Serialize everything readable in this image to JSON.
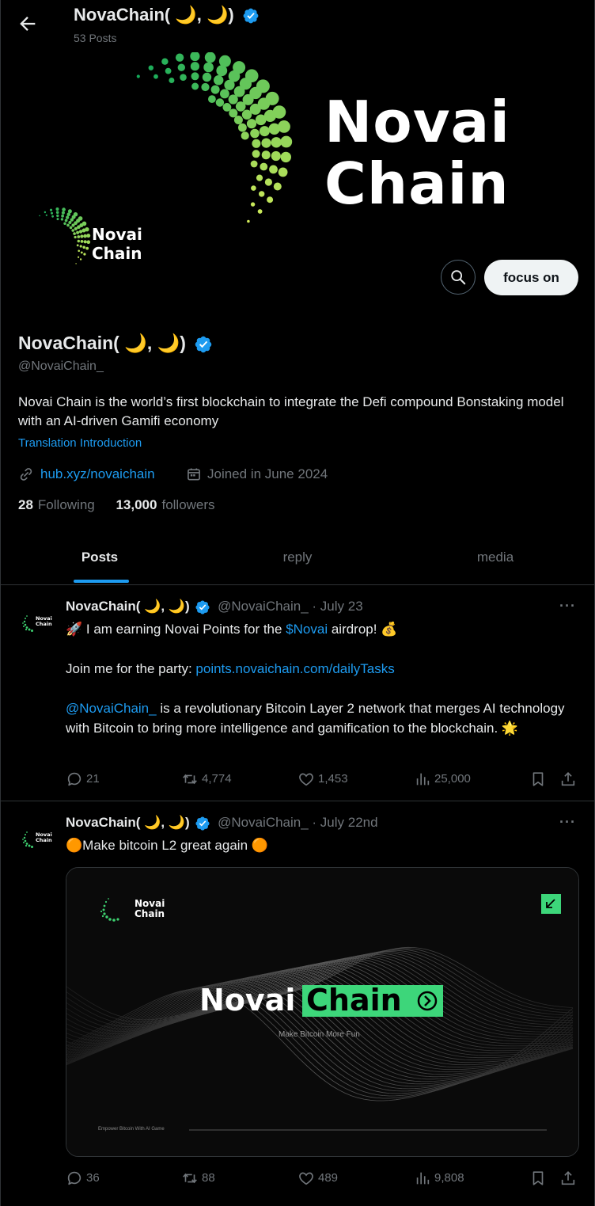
{
  "header": {
    "back_icon": "arrow-left-icon",
    "name": "NovaChain( 🌙, 🌙)",
    "posts_count": "53 Posts"
  },
  "banner": {
    "title_line1": "Novai",
    "title_line2": "Chain",
    "logo_line1": "Novai",
    "logo_line2": "Chain"
  },
  "actions": {
    "search_icon": "search-icon",
    "follow_label": "focus on"
  },
  "profile": {
    "name": "NovaChain( 🌙, 🌙)",
    "handle": "@NovaiChain_",
    "bio": "Novai Chain is the world’s first blockchain to integrate the Defi compound Bonstaking model with an AI-driven Gamifi economy",
    "translation": "Translation Introduction",
    "link": "hub.xyz/novaichain",
    "joined": "Joined in June 2024",
    "following_count": "28",
    "following_label": "Following",
    "followers_count": "13,000",
    "followers_label": "followers"
  },
  "tabs": [
    {
      "label": "Posts"
    },
    {
      "label": "reply"
    },
    {
      "label": "media"
    }
  ],
  "posts": [
    {
      "name": "NovaChain( 🌙, 🌙)",
      "meta": "@NovaiChain_ · July 23",
      "line1_pre": "🚀 I am earning Novai Points for the ",
      "line1_link": "$Novai",
      "line1_post": " airdrop! 💰",
      "line2_pre": "Join me for the party: ",
      "line2_link": "points.novaichain.com/dailyTasks",
      "line3_link": "@NovaiChain_",
      "line3_post": " is a revolutionary Bitcoin Layer 2 network that merges AI technology with Bitcoin to bring more intelligence and gamification to the blockchain. 🌟",
      "replies": "21",
      "reposts": "4,774",
      "likes": "1,453",
      "views": "25,000"
    },
    {
      "name": "NovaChain( 🌙, 🌙)",
      "meta": "@NovaiChain_ · July 22nd",
      "text": "🟠Make bitcoin L2 great again 🟠",
      "media": {
        "logo_line1": "Novai",
        "logo_line2": "Chain",
        "title_left": "Novai",
        "title_right": "Chain",
        "tagline": "Make Bitcoin More Fun",
        "footer": "Empower Bitcoin With AI Game"
      },
      "replies": "36",
      "reposts": "88",
      "likes": "489",
      "views": "9,808"
    }
  ]
}
